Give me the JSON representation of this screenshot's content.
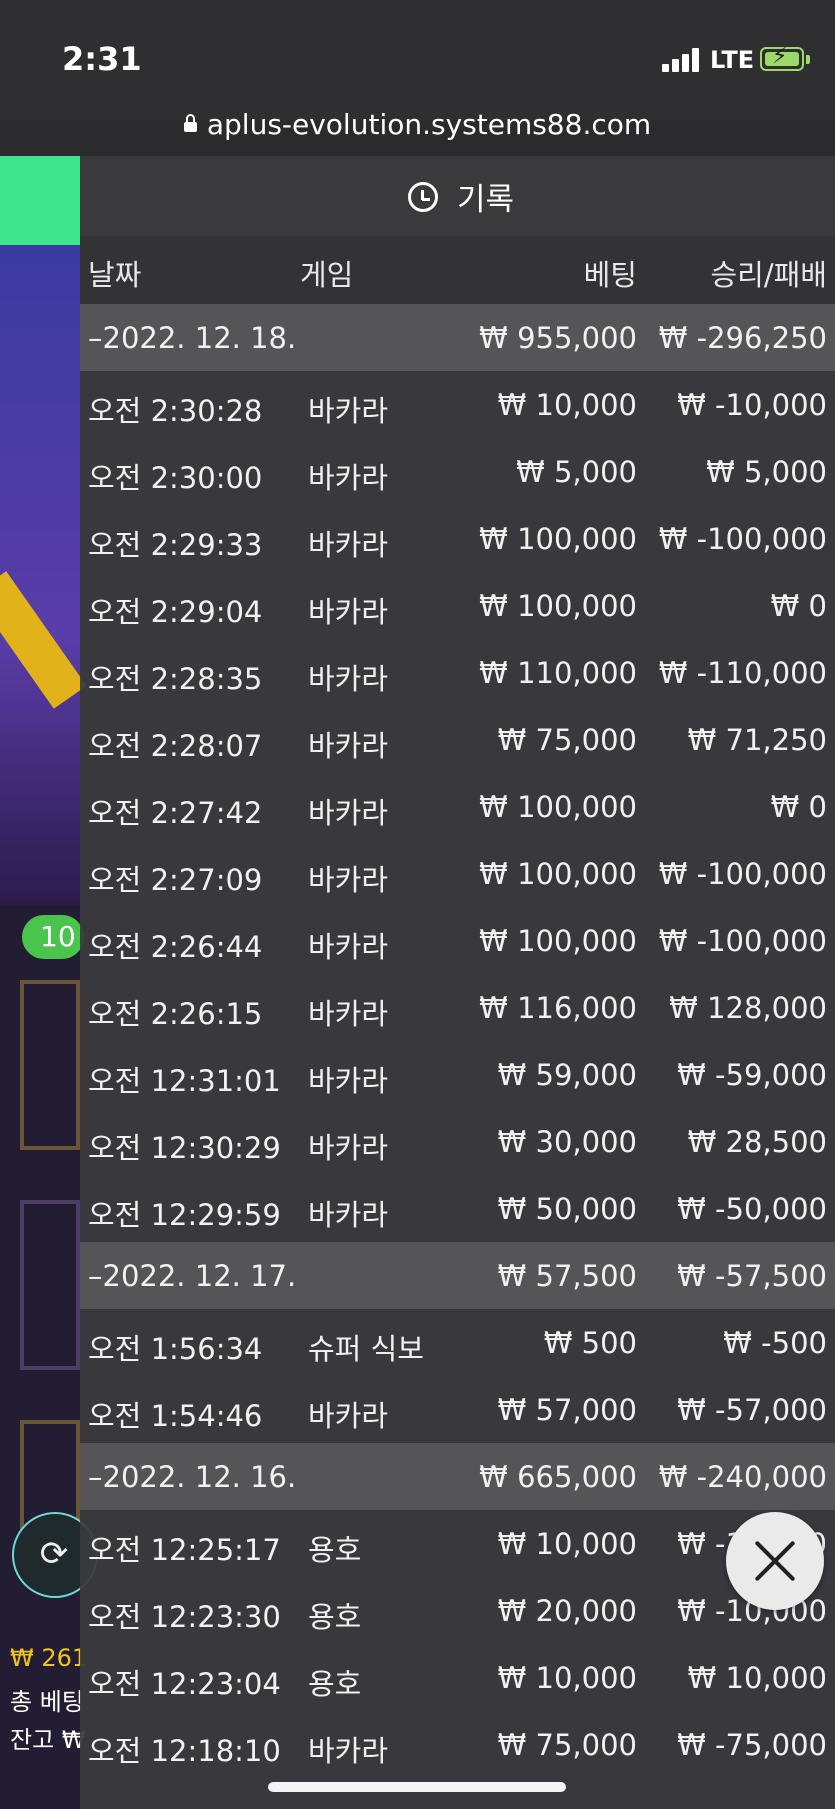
{
  "status_bar": {
    "time": "2:31",
    "network": "LTE"
  },
  "browser": {
    "url": "aplus-evolution.systems88.com"
  },
  "background": {
    "badge": "10",
    "balance_1": "₩ 261",
    "balance_2": "총 베팅",
    "balance_3": "잔고 ₩"
  },
  "history": {
    "title": "기록",
    "columns": {
      "date": "날짜",
      "game": "게임",
      "bet": "베팅",
      "winloss": "승리/패배"
    },
    "rows": [
      {
        "type": "date",
        "time": "–2022. 12. 18.",
        "game": "",
        "bet": "₩ 955,000",
        "winloss": "₩ -296,250"
      },
      {
        "type": "item",
        "time": "오전 2:30:28",
        "game": "바카라",
        "bet": "₩ 10,000",
        "winloss": "₩ -10,000"
      },
      {
        "type": "item",
        "time": "오전 2:30:00",
        "game": "바카라",
        "bet": "₩ 5,000",
        "winloss": "₩ 5,000"
      },
      {
        "type": "item",
        "time": "오전 2:29:33",
        "game": "바카라",
        "bet": "₩ 100,000",
        "winloss": "₩ -100,000"
      },
      {
        "type": "item",
        "time": "오전 2:29:04",
        "game": "바카라",
        "bet": "₩ 100,000",
        "winloss": "₩ 0"
      },
      {
        "type": "item",
        "time": "오전 2:28:35",
        "game": "바카라",
        "bet": "₩ 110,000",
        "winloss": "₩ -110,000"
      },
      {
        "type": "item",
        "time": "오전 2:28:07",
        "game": "바카라",
        "bet": "₩ 75,000",
        "winloss": "₩ 71,250"
      },
      {
        "type": "item",
        "time": "오전 2:27:42",
        "game": "바카라",
        "bet": "₩ 100,000",
        "winloss": "₩ 0"
      },
      {
        "type": "item",
        "time": "오전 2:27:09",
        "game": "바카라",
        "bet": "₩ 100,000",
        "winloss": "₩ -100,000"
      },
      {
        "type": "item",
        "time": "오전 2:26:44",
        "game": "바카라",
        "bet": "₩ 100,000",
        "winloss": "₩ -100,000"
      },
      {
        "type": "item",
        "time": "오전 2:26:15",
        "game": "바카라",
        "bet": "₩ 116,000",
        "winloss": "₩ 128,000"
      },
      {
        "type": "item",
        "time": "오전 12:31:01",
        "game": "바카라",
        "bet": "₩ 59,000",
        "winloss": "₩ -59,000"
      },
      {
        "type": "item",
        "time": "오전 12:30:29",
        "game": "바카라",
        "bet": "₩ 30,000",
        "winloss": "₩ 28,500"
      },
      {
        "type": "item",
        "time": "오전 12:29:59",
        "game": "바카라",
        "bet": "₩ 50,000",
        "winloss": "₩ -50,000"
      },
      {
        "type": "date",
        "time": "–2022. 12. 17.",
        "game": "",
        "bet": "₩ 57,500",
        "winloss": "₩ -57,500"
      },
      {
        "type": "item",
        "time": "오전 1:56:34",
        "game": "슈퍼 식보",
        "bet": "₩ 500",
        "winloss": "₩ -500"
      },
      {
        "type": "item",
        "time": "오전 1:54:46",
        "game": "바카라",
        "bet": "₩ 57,000",
        "winloss": "₩ -57,000"
      },
      {
        "type": "date",
        "time": "–2022. 12. 16.",
        "game": "",
        "bet": "₩ 665,000",
        "winloss": "₩ -240,000"
      },
      {
        "type": "item",
        "time": "오전 12:25:17",
        "game": "용호",
        "bet": "₩ 10,000",
        "winloss": "₩ -10,000"
      },
      {
        "type": "item",
        "time": "오전 12:23:30",
        "game": "용호",
        "bet": "₩ 20,000",
        "winloss": "₩ -10,000"
      },
      {
        "type": "item",
        "time": "오전 12:23:04",
        "game": "용호",
        "bet": "₩ 10,000",
        "winloss": "₩ 10,000"
      },
      {
        "type": "item",
        "time": "오전 12:18:10",
        "game": "바카라",
        "bet": "₩ 75,000",
        "winloss": "₩ -75,000"
      }
    ]
  }
}
